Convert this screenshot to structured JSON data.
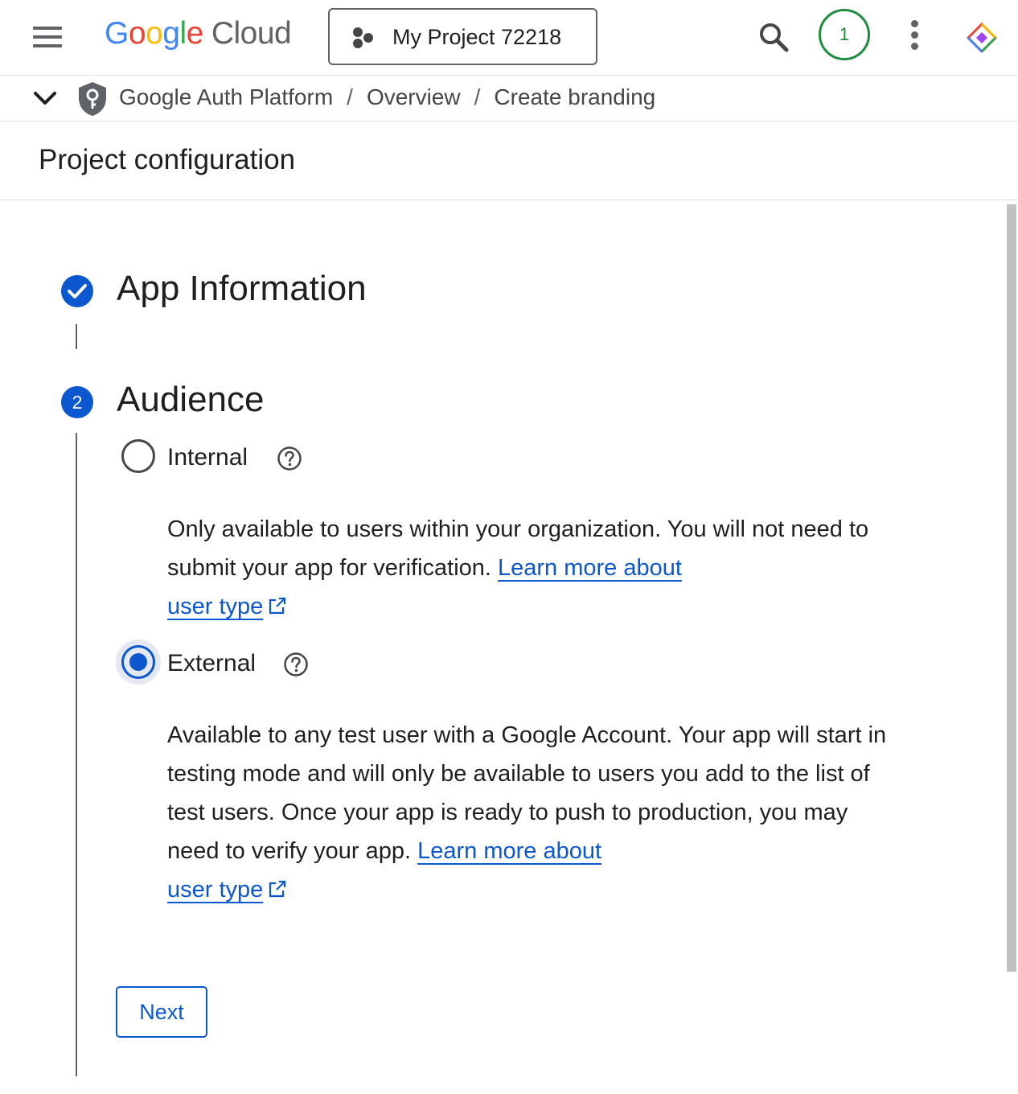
{
  "header": {
    "logo": {
      "google": "Google",
      "cloud": "Cloud"
    },
    "project_name": "My Project 72218",
    "notification_count": "1",
    "icons": [
      "menu-icon",
      "project-icon",
      "search-icon",
      "more-vert-icon",
      "gemini-icon"
    ]
  },
  "breadcrumb": {
    "items": [
      "Google Auth Platform",
      "Overview",
      "Create branding"
    ],
    "separator": "/"
  },
  "page": {
    "title": "Project configuration"
  },
  "stepper": {
    "step1": {
      "title": "App Information",
      "status": "completed"
    },
    "step2": {
      "number": "2",
      "title": "Audience",
      "options": {
        "internal": {
          "label": "Internal",
          "selected": false,
          "description": "Only available to users within your organization. You will not need to submit your app for verification. ",
          "link_line1": "Learn more about",
          "link_line2": "user type"
        },
        "external": {
          "label": "External",
          "selected": true,
          "description": "Available to any test user with a Google Account. Your app will start in testing mode and will only be available to users you add to the list of test users. Once your app is ready to push to production, you may need to verify your app. ",
          "link_line1": "Learn more about",
          "link_line2": "user type"
        }
      },
      "next_label": "Next"
    }
  },
  "colors": {
    "accent": "#0b57d0",
    "notification": "#1e8e3e",
    "text": "#1f1f1f",
    "muted": "#5f6368"
  }
}
